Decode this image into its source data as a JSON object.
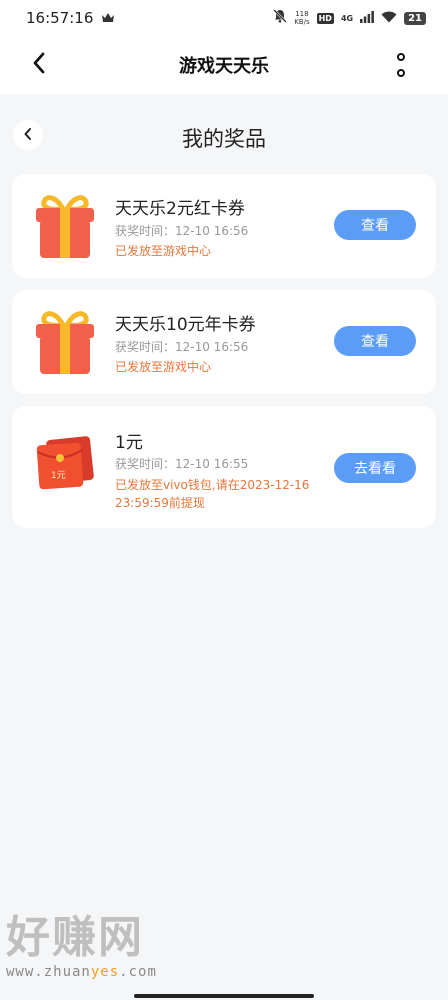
{
  "status_bar": {
    "time": "16:57:16",
    "speed_value": "118",
    "speed_unit": "KB/s",
    "hd": "HD",
    "network": "4G",
    "battery": "21"
  },
  "header": {
    "title": "游戏天天乐"
  },
  "page": {
    "title": "我的奖品"
  },
  "prizes": [
    {
      "title": "天天乐2元红卡券",
      "time": "获奖时间：12-10 16:56",
      "status": "已发放至游戏中心",
      "button": "查看",
      "icon": "gift-box-icon"
    },
    {
      "title": "天天乐10元年卡券",
      "time": "获奖时间：12-10 16:56",
      "status": "已发放至游戏中心",
      "button": "查看",
      "icon": "gift-box-icon"
    },
    {
      "title": "1元",
      "time": "获奖时间：12-10 16:55",
      "status": "已发放至vivo钱包,请在2023-12-16 23:59:59前提现",
      "button": "去看看",
      "icon": "red-envelope-icon",
      "envelope_label": "1元"
    }
  ],
  "watermark": {
    "logo": "好赚网",
    "url_prefix": "www.zhuan",
    "url_accent": "yes",
    "url_suffix": ".com"
  },
  "colors": {
    "accent_button": "#5b9cf6",
    "status_text": "#e8773a",
    "background": "#f5f6f8"
  }
}
